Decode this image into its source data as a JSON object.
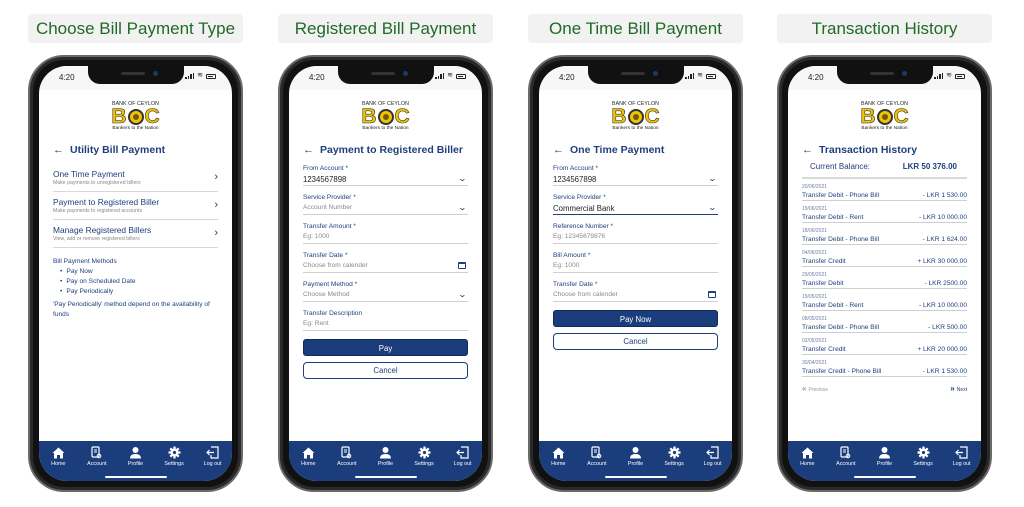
{
  "screens": [
    {
      "caption": "Choose Bill Payment Type",
      "status_time": "4:20",
      "logo": {
        "bank": "BANK OF CEYLON",
        "left": "B",
        "right": "C",
        "tagline": "Bankers to the Nation"
      },
      "title": "Utility Bill Payment",
      "menu": [
        {
          "title": "One Time Payment",
          "subtitle": "Make payments to unregistered billers"
        },
        {
          "title": "Payment to Registered Biller",
          "subtitle": "Make payments to registered accounts"
        },
        {
          "title": "Manage Registered Billers",
          "subtitle": "View, add or remove registered billers"
        }
      ],
      "notes": {
        "heading": "Bill Payment Methods",
        "items": [
          "Pay Now",
          "Pay on Scheduled Date",
          "Pay Periodically"
        ],
        "footer": "'Pay Periodically' method depend on the availability of funds"
      }
    },
    {
      "caption": "Registered Bill Payment",
      "status_time": "4:20",
      "logo": {
        "bank": "BANK OF CEYLON",
        "left": "B",
        "right": "C",
        "tagline": "Bankers to the Nation"
      },
      "title": "Payment to Registered Biller",
      "fields": [
        {
          "label": "From Account *",
          "value": "1234567898",
          "placeholder": "",
          "control": "dropdown"
        },
        {
          "label": "Service Provider *",
          "value": "",
          "placeholder": "Account Number",
          "control": "dropdown"
        },
        {
          "label": "Transfer Amount *",
          "value": "",
          "placeholder": "Eg: 1000",
          "control": "text"
        },
        {
          "label": "Transfer Date *",
          "value": "",
          "placeholder": "Choose from calender",
          "control": "calendar"
        },
        {
          "label": "Payment Method *",
          "value": "",
          "placeholder": "Choose Method",
          "control": "dropdown"
        },
        {
          "label": "Transfer Description",
          "value": "",
          "placeholder": "Eg: Rent",
          "control": "text"
        }
      ],
      "primary_button": "Pay",
      "secondary_button": "Cancel"
    },
    {
      "caption": "One Time Bill Payment",
      "status_time": "4:20",
      "logo": {
        "bank": "BANK OF CEYLON",
        "left": "B",
        "right": "C",
        "tagline": "Bankers to the Nation"
      },
      "title": "One Time Payment",
      "fields": [
        {
          "label": "From Account *",
          "value": "1234567898",
          "placeholder": "",
          "control": "dropdown"
        },
        {
          "label": "Service Provider *",
          "value": "Commercial Bank",
          "placeholder": "",
          "control": "dropdown"
        },
        {
          "label": "Reference Number *",
          "value": "",
          "placeholder": "Eg: 12345679876",
          "control": "text"
        },
        {
          "label": "Bill Amount *",
          "value": "",
          "placeholder": "Eg: 1000",
          "control": "text"
        },
        {
          "label": "Transfer Date *",
          "value": "",
          "placeholder": "Choose from calender",
          "control": "calendar"
        }
      ],
      "primary_button": "Pay Now",
      "secondary_button": "Cancel"
    },
    {
      "caption": "Transaction History",
      "status_time": "4:20",
      "logo": {
        "bank": "BANK OF CEYLON",
        "left": "B",
        "right": "C",
        "tagline": "Bankers to the Nation"
      },
      "title": "Transaction History",
      "balance_label": "Current Balance:",
      "balance_value": "LKR 50 376.00",
      "transactions": [
        {
          "date": "20/06/2021",
          "desc": "Transfer Debit - Phone Bill",
          "amount": "- LKR 1 530.00"
        },
        {
          "date": "19/06/2021",
          "desc": "Transfer Debit - Rent",
          "amount": "- LKR 10 000.00"
        },
        {
          "date": "18/06/2021",
          "desc": "Transfer Debit - Phone Bill",
          "amount": "- LKR 1 624.00"
        },
        {
          "date": "04/06/2021",
          "desc": "Transfer Credit",
          "amount": "+ LKR 30 000.00"
        },
        {
          "date": "29/05/2021",
          "desc": "Transfer Debit",
          "amount": "- LKR 2500.00"
        },
        {
          "date": "19/05/2021",
          "desc": "Transfer Debit - Rent",
          "amount": "- LKR 10 000.00"
        },
        {
          "date": "08/05/2021",
          "desc": "Transfer Debit - Phone Bill",
          "amount": "- LKR 500.00"
        },
        {
          "date": "02/05/2021",
          "desc": "Transfer Credit",
          "amount": "+ LKR 20 000.00"
        },
        {
          "date": "30/04/2021",
          "desc": "Transfer Credit - Phone Bill",
          "amount": "- LKR 1 530.00"
        }
      ],
      "pager": {
        "previous": "Previous",
        "next": "Next"
      }
    }
  ],
  "tabbar": [
    {
      "label": "Home",
      "icon": "home-icon"
    },
    {
      "label": "Account",
      "icon": "account-statement-icon"
    },
    {
      "label": "Profile",
      "icon": "user-icon"
    },
    {
      "label": "Settings",
      "icon": "gear-icon"
    },
    {
      "label": "Log out",
      "icon": "logout-icon"
    }
  ],
  "colors": {
    "brand_blue": "#1b3d7b",
    "caption_green": "#1f6b25",
    "logo_yellow": "#f2c400"
  }
}
